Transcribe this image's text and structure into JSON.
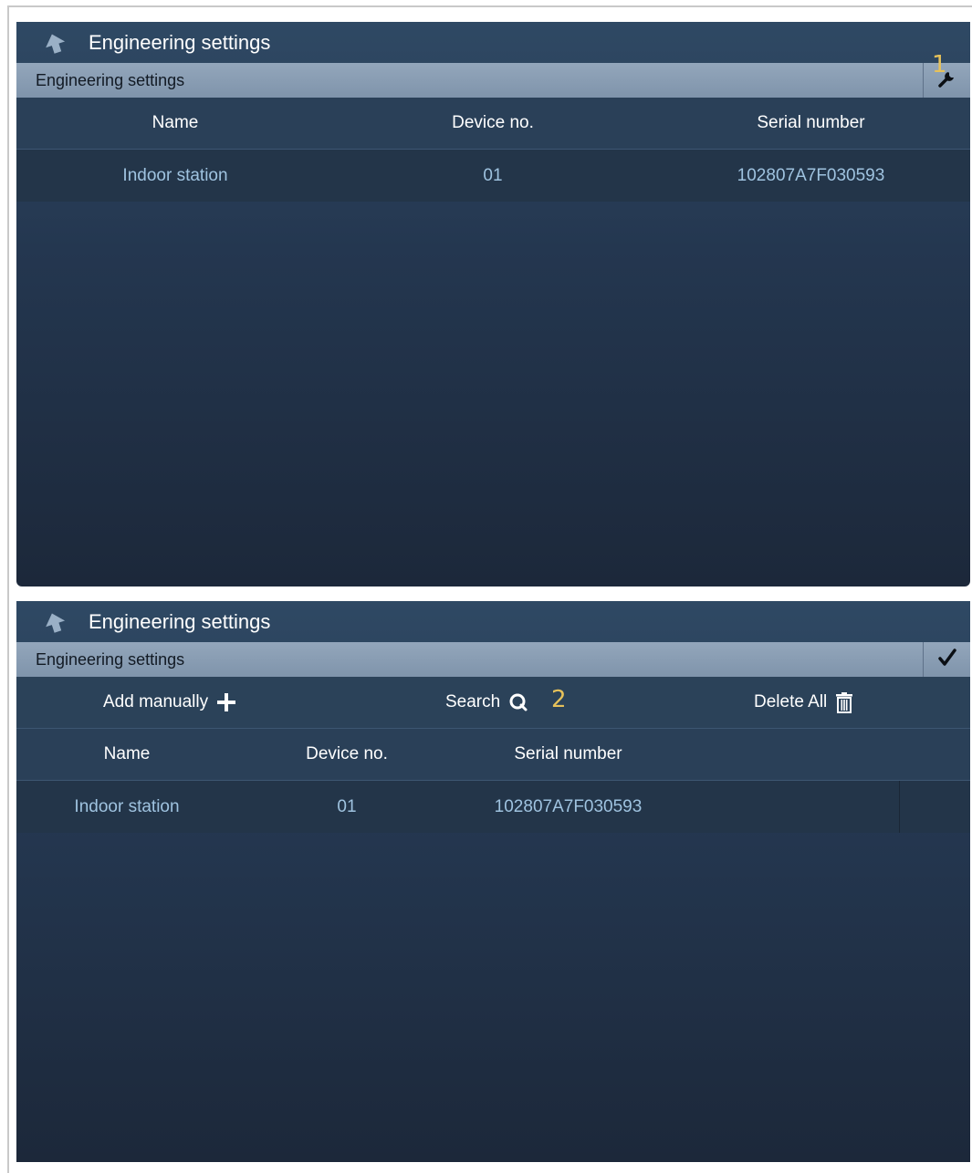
{
  "screen1": {
    "title": "Engineering settings",
    "subbar_label": "Engineering settings",
    "settings_icon": "wrench-icon",
    "callout": "1",
    "columns": [
      "Name",
      "Device no.",
      "Serial number"
    ],
    "rows": [
      [
        "Indoor station",
        "01",
        "102807A7F030593"
      ]
    ]
  },
  "screen2": {
    "title": "Engineering settings",
    "subbar_label": "Engineering settings",
    "confirm_icon": "checkmark-icon",
    "callout": "2",
    "toolbar": {
      "add_label": "Add manually",
      "add_icon": "plus-icon",
      "search_label": "Search",
      "search_icon": "search-icon",
      "delete_label": "Delete All",
      "delete_icon": "trash-icon"
    },
    "columns": [
      "Name",
      "Device no.",
      "Serial number"
    ],
    "rows": [
      [
        "Indoor station",
        "01",
        "102807A7F030593"
      ]
    ]
  },
  "colors": {
    "accent_callout": "#e6c15a",
    "subbar": "#8a9db2",
    "row_text": "#9fc3e0"
  }
}
